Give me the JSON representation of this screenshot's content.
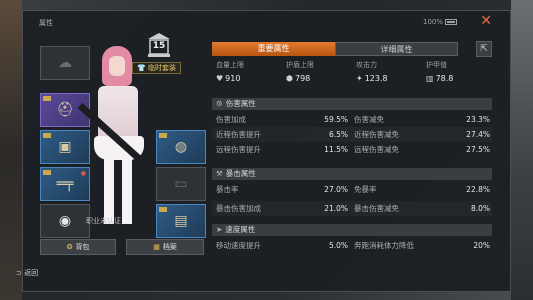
{
  "window": {
    "title": "属性",
    "battery": "100%"
  },
  "left": {
    "temp_outfit_label": "临时套装",
    "level": "15",
    "certification": "职业未认证",
    "backpack_label": "背包",
    "profile_label": "档案",
    "back_label": "返回"
  },
  "tabs": {
    "primary": "重要属性",
    "secondary": "详细属性"
  },
  "top_stats": [
    {
      "label": "血量上限",
      "value": "910",
      "icon": "heart-icon"
    },
    {
      "label": "护盾上限",
      "value": "798",
      "icon": "shield-icon"
    },
    {
      "label": "攻击力",
      "value": "123.8",
      "icon": "attack-icon"
    },
    {
      "label": "护甲值",
      "value": "78.8",
      "icon": "armor-icon"
    }
  ],
  "sections": [
    {
      "title": "伤害属性",
      "rows": [
        {
          "name1": "伤害加成",
          "val1": "59.5%",
          "name2": "伤害减免",
          "val2": "23.3%"
        },
        {
          "name1": "近程伤害提升",
          "val1": "6.5%",
          "name2": "近程伤害减免",
          "val2": "27.4%"
        },
        {
          "name1": "远程伤害提升",
          "val1": "11.5%",
          "name2": "远程伤害减免",
          "val2": "27.5%"
        }
      ]
    },
    {
      "title": "暴击属性",
      "rows": [
        {
          "name1": "暴击率",
          "val1": "27.0%",
          "name2": "免暴率",
          "val2": "22.8%"
        },
        {
          "name1": "暴击伤害加成",
          "val1": "21.0%",
          "name2": "暴击伤害减免",
          "val2": "8.0%"
        }
      ]
    },
    {
      "title": "速度属性",
      "rows": [
        {
          "name1": "移动速度提升",
          "val1": "5.0%",
          "name2": "奔跑消耗体力降低",
          "val2": "20%"
        }
      ]
    }
  ],
  "colors": {
    "accent": "#e57a2c",
    "close": "#e8683a",
    "gold": "#e8c76a"
  }
}
